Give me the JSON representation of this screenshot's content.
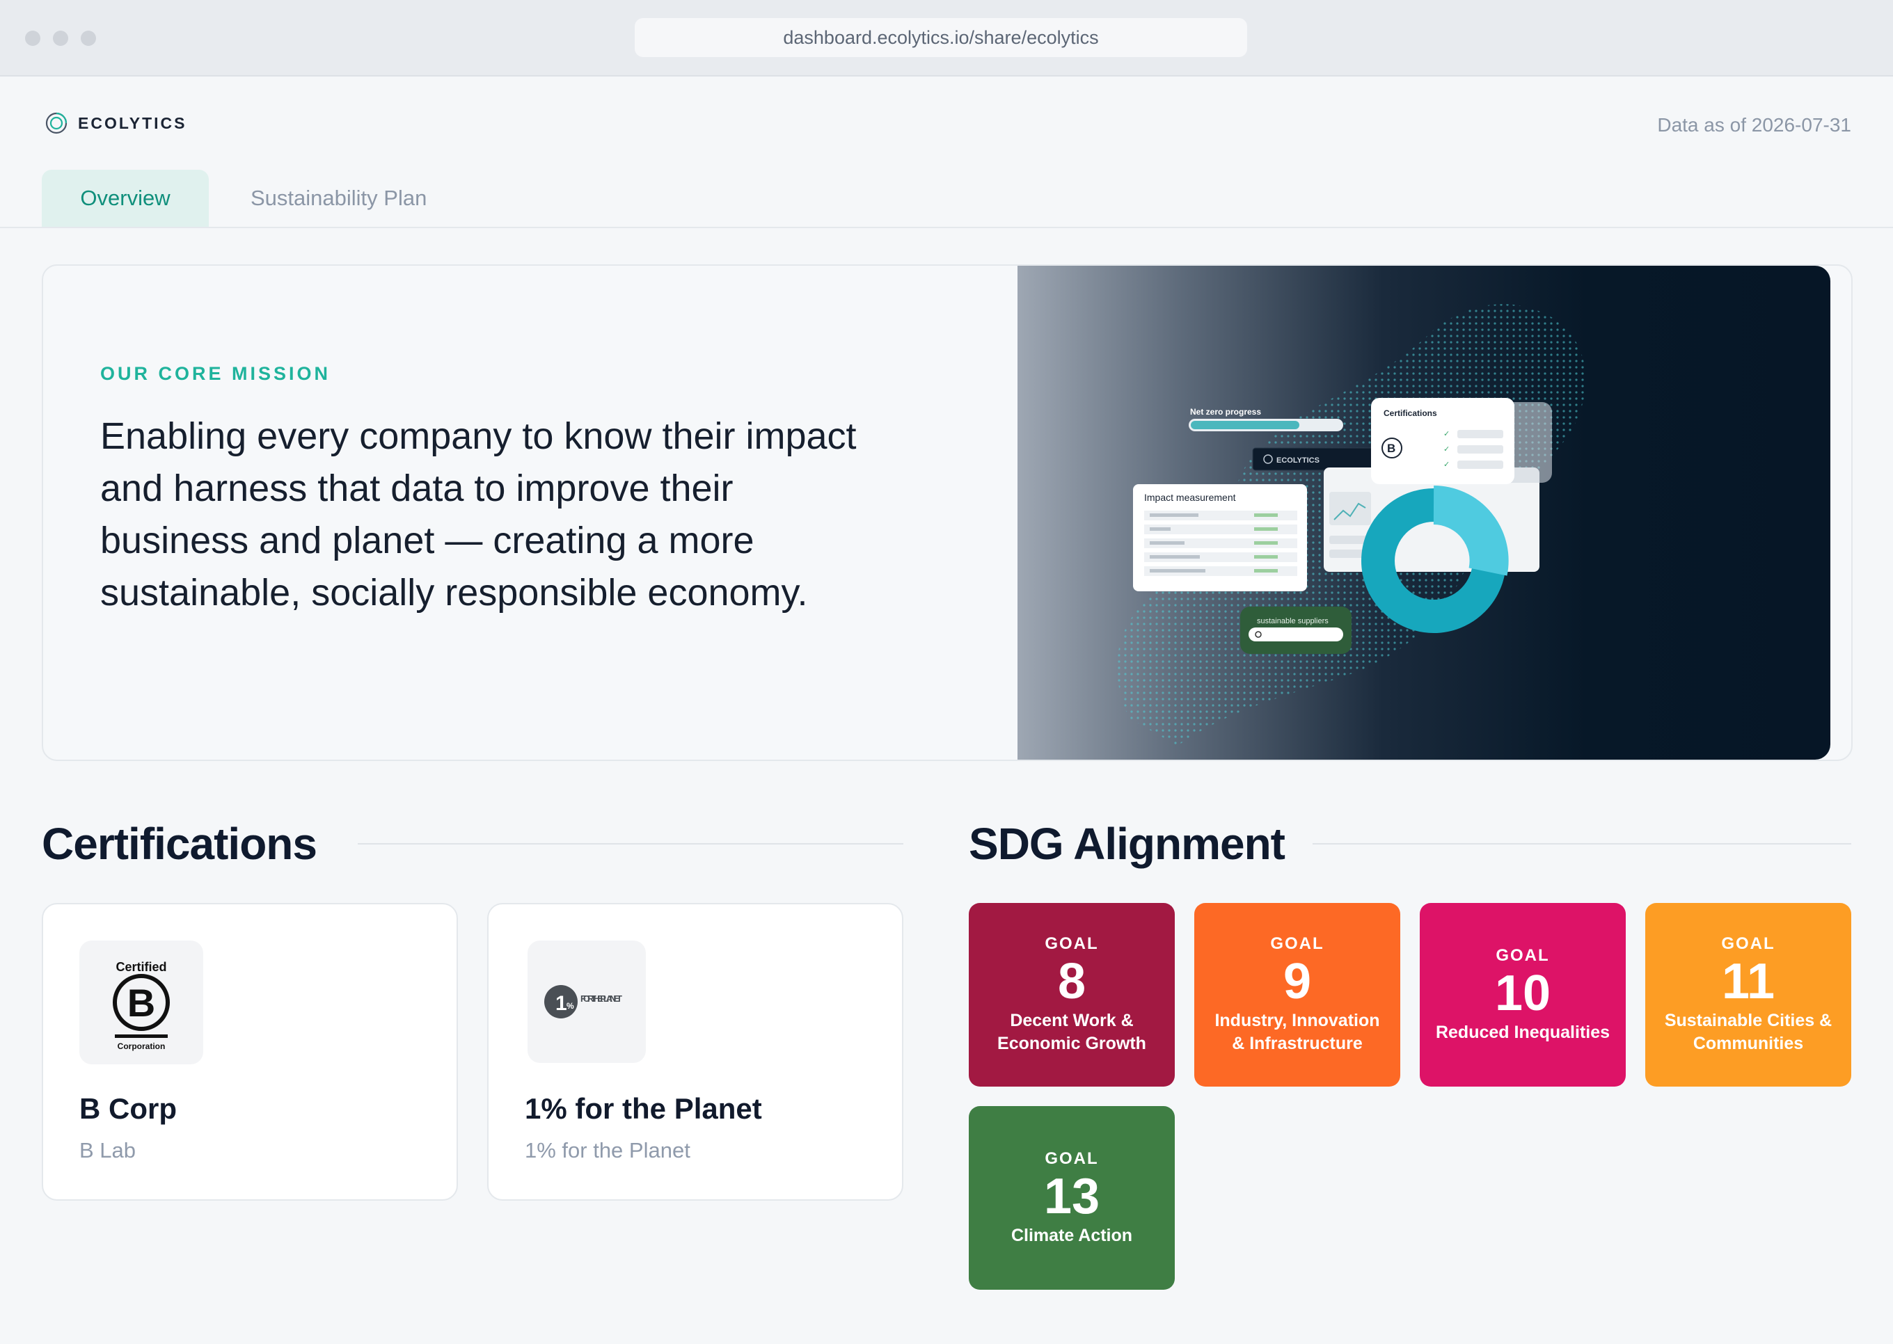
{
  "browser": {
    "url": "dashboard.ecolytics.io/share/ecolytics"
  },
  "header": {
    "brand": "ECOLYTICS",
    "data_as_of": "Data as of 2026-07-31"
  },
  "tabs": [
    {
      "label": "Overview",
      "active": true
    },
    {
      "label": "Sustainability Plan",
      "active": false
    }
  ],
  "hero": {
    "eyebrow": "OUR CORE MISSION",
    "mission": "Enabling every company to know their impact and harness that data to improve their business and planet — creating a more sustainable, socially responsible economy.",
    "mockup": {
      "net_zero_label": "Net zero progress",
      "brand": "ECOLYTICS",
      "certifications_label": "Certifications",
      "impact_label": "Impact measurement",
      "suppliers_label": "sustainable suppliers",
      "net_zero_progress": 0.72
    }
  },
  "certifications": {
    "title": "Certifications",
    "items": [
      {
        "name": "B Corp",
        "issuer": "B Lab",
        "logo": "b-corp-logo",
        "logo_text_top": "Certified",
        "logo_text_bottom": "Corporation"
      },
      {
        "name": "1% for the Planet",
        "issuer": "1% for the Planet",
        "logo": "one-percent-planet-logo",
        "logo_text": "FOR THE PLANET"
      }
    ]
  },
  "sdg": {
    "title": "SDG Alignment",
    "goal_label": "GOAL",
    "goals": [
      {
        "number": "8",
        "name": "Decent Work & Economic Growth",
        "color": "#a21942"
      },
      {
        "number": "9",
        "name": "Industry, Innovation & Infrastructure",
        "color": "#fd6925"
      },
      {
        "number": "10",
        "name": "Reduced Inequalities",
        "color": "#dd1367"
      },
      {
        "number": "11",
        "name": "Sustainable Cities & Communities",
        "color": "#fd9d24"
      },
      {
        "number": "13",
        "name": "Climate Action",
        "color": "#3f7e44"
      }
    ]
  },
  "colors": {
    "accent": "#1fb39c",
    "tab_active_bg": "#e0f1ee",
    "tab_active_text": "#0f8f7b"
  }
}
